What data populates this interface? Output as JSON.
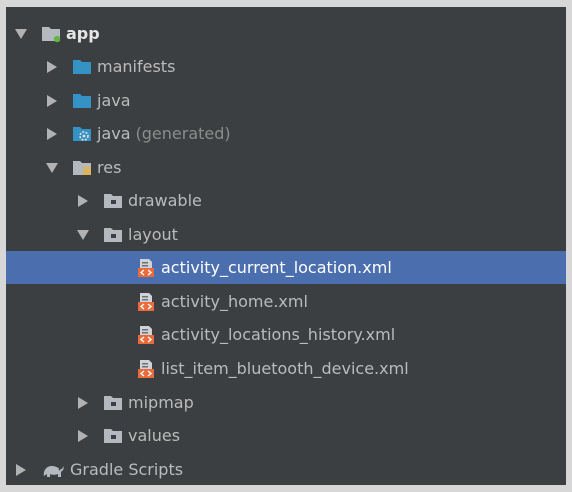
{
  "colors": {
    "panel_bg": "#3c3f41",
    "selection_bg": "#4b6eaf",
    "text": "#bbbbbb",
    "folder_blue": "#3592c4",
    "folder_gray": "#b4b9bf",
    "xml_orange": "#e96a3a"
  },
  "tree": {
    "app": {
      "label": "app",
      "icon": "module-folder-icon"
    },
    "manifests": {
      "label": "manifests",
      "icon": "folder-icon"
    },
    "java": {
      "label": "java",
      "icon": "folder-icon"
    },
    "java_generated": {
      "label": "java",
      "suffix": "(generated)",
      "icon": "generated-folder-icon"
    },
    "res": {
      "label": "res",
      "icon": "resource-folder-icon"
    },
    "drawable": {
      "label": "drawable",
      "icon": "resource-subfolder-icon"
    },
    "layout": {
      "label": "layout",
      "icon": "resource-subfolder-icon"
    },
    "files": [
      {
        "label": "activity_current_location.xml",
        "icon": "layout-xml-icon",
        "selected": true
      },
      {
        "label": "activity_home.xml",
        "icon": "layout-xml-icon"
      },
      {
        "label": "activity_locations_history.xml",
        "icon": "layout-xml-icon"
      },
      {
        "label": "list_item_bluetooth_device.xml",
        "icon": "layout-xml-icon"
      }
    ],
    "mipmap": {
      "label": "mipmap",
      "icon": "resource-subfolder-icon"
    },
    "values": {
      "label": "values",
      "icon": "resource-subfolder-icon"
    },
    "gradle": {
      "label": "Gradle Scripts",
      "icon": "gradle-elephant-icon"
    }
  }
}
